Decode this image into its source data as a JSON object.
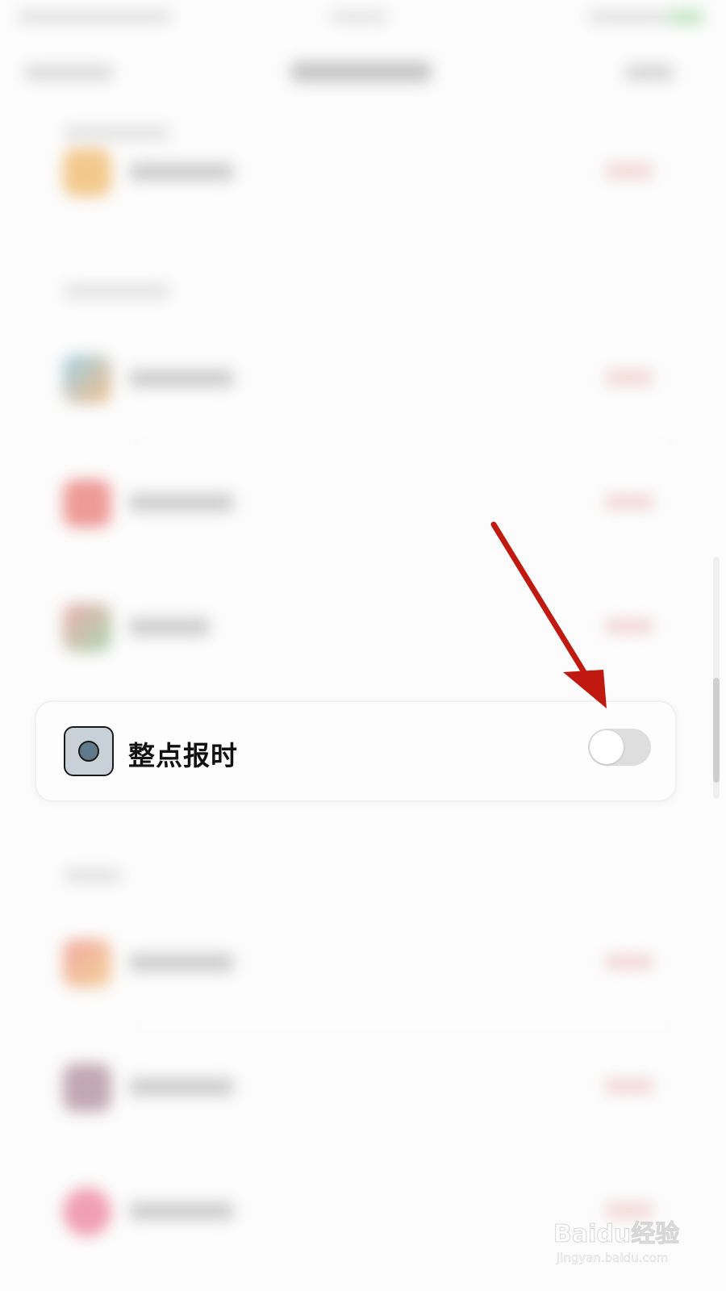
{
  "setting": {
    "label": "整点报时",
    "toggle_on": false
  },
  "colors": {
    "toggle_track_off": "#dedede",
    "icon_fill": "#c8d0d8",
    "icon_dot": "#617a8b",
    "arrow": "#c0190f"
  },
  "icons": {
    "setting_icon": "record-dot-icon"
  },
  "watermark": {
    "brand": "Baidu经验",
    "url": "jingyan.baidu.com"
  }
}
